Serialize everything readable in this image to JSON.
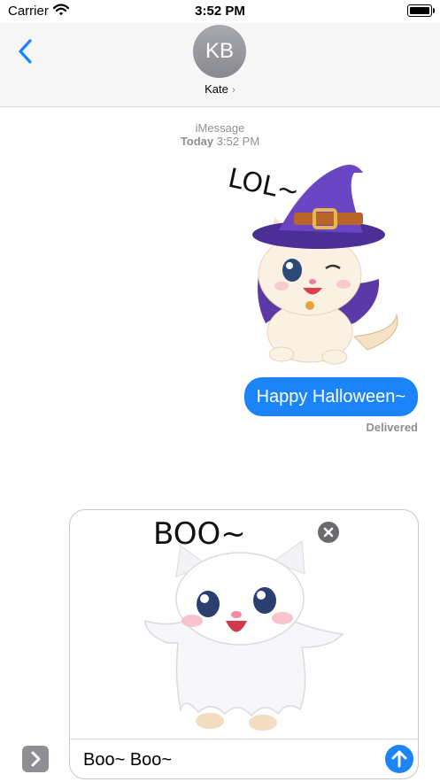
{
  "status_bar": {
    "carrier": "Carrier",
    "time": "3:52 PM"
  },
  "header": {
    "avatar_initials": "KB",
    "contact_name": "Kate",
    "contact_chevron": "›"
  },
  "conversation": {
    "service_label": "iMessage",
    "day_label": "Today",
    "time_label": "3:52 PM",
    "sticker_caption": "LOL~",
    "sent_message": "Happy Halloween~",
    "delivery_status": "Delivered"
  },
  "compose": {
    "sticker_caption": "BOO~",
    "text_value": "Boo~ Boo~"
  },
  "colors": {
    "accent": "#1a84f8",
    "header_bg": "#f6f6f6",
    "meta_gray": "#8e8e93"
  },
  "icons": [
    "wifi-icon",
    "battery-icon",
    "back-chevron-icon",
    "app-drawer-icon",
    "remove-icon",
    "send-arrow-icon"
  ]
}
